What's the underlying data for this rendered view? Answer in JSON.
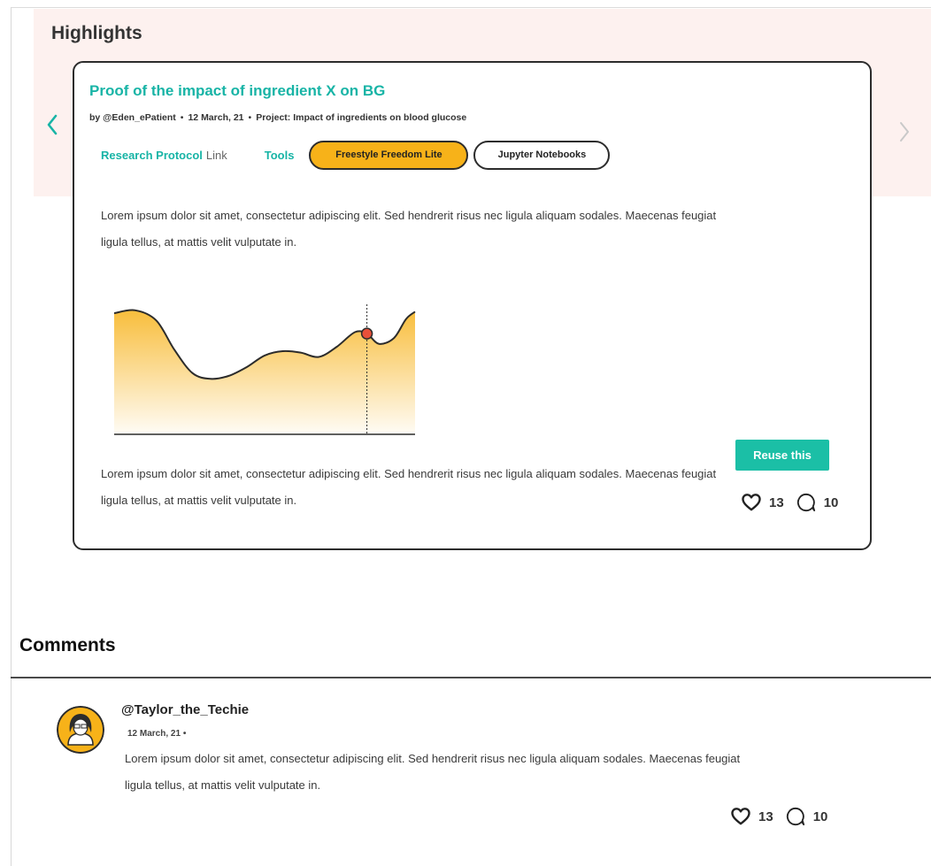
{
  "highlights": {
    "title": "Highlights"
  },
  "card": {
    "title": "Proof of the impact of ingredient X on BG",
    "byline_author": "by @Eden_ePatient",
    "byline_sep1": "•",
    "byline_date": "12 March, 21",
    "byline_sep2": "•",
    "byline_project": "Project: Impact of ingredients on blood glucose",
    "research_protocol_label": "Research Protocol",
    "research_protocol_link": "Link",
    "tools_label": "Tools",
    "tags": [
      "Freestyle Freedom Lite",
      "Jupyter Notebooks"
    ],
    "paragraph1": "Lorem ipsum dolor sit amet, consectetur adipiscing elit. Sed hendrerit risus nec ligula aliquam sodales. Maecenas feugiat ligula tellus, at mattis velit vulputate in.",
    "paragraph2": "Lorem ipsum dolor sit amet, consectetur adipiscing elit. Sed hendrerit risus nec ligula aliquam sodales. Maecenas feugiat ligula tellus, at mattis velit vulputate in.",
    "reuse_label": "Reuse this",
    "likes": "13",
    "comments_count": "10"
  },
  "chart_data": {
    "type": "area",
    "title": "",
    "xlabel": "",
    "ylabel": "",
    "grid": false,
    "fill_color": "#f7b219",
    "line_color": "#2c2c2c",
    "marker_color": "#e8503a",
    "ylim": [
      0,
      100
    ],
    "xlim": [
      0,
      100
    ],
    "x": [
      0,
      7,
      14,
      20,
      26,
      32,
      38,
      44,
      50,
      56,
      62,
      68,
      74,
      80,
      84,
      88,
      93,
      97,
      100
    ],
    "values": [
      83,
      85,
      78,
      58,
      42,
      38,
      40,
      46,
      54,
      57,
      56,
      53,
      60,
      70,
      69,
      62,
      66,
      79,
      84
    ],
    "highlight_x": 84,
    "highlight_y": 69
  },
  "comments": {
    "title": "Comments",
    "items": [
      {
        "user": "@Taylor_the_Techie",
        "date": "12 March, 21 •",
        "text": "Lorem ipsum dolor sit amet, consectetur adipiscing elit. Sed hendrerit risus nec ligula aliquam sodales. Maecenas feugiat ligula tellus, at mattis velit vulputate in.",
        "likes": "13",
        "comments_count": "10"
      }
    ]
  },
  "icons": {
    "prev": "chevron-left-icon",
    "next": "chevron-right-icon",
    "like": "heart-icon",
    "comment": "comment-bubble-icon"
  },
  "colors": {
    "accent": "#18b4a6",
    "button": "#1bbfa6",
    "tag_highlight": "#f7b219",
    "band": "#fdf1ef"
  }
}
